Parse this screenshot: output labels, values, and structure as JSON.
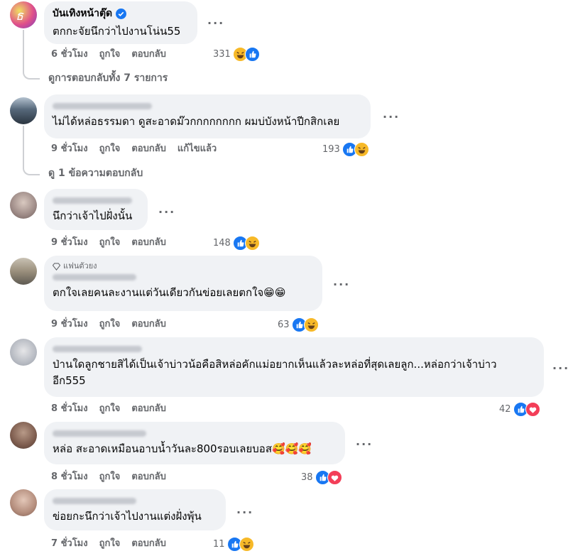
{
  "comments": [
    {
      "name": "บันเทิงหน้าตุ๊ด",
      "text": "ตกกะจัยนึกว่าไปงานโน่น55",
      "time": "6 ชั่วโมง",
      "like": "ถูกใจ",
      "reply": "ตอบกลับ",
      "count": "331",
      "view_replies": "ดูการตอบกลับทั้ง 7 รายการ"
    },
    {
      "text": "ไม่ได้หล่อธรรมดา ดูสะอาดม๊วกกกกกกกก ผมบ่บังหน้าปีกสิกเลย",
      "time": "9 ชั่วโมง",
      "like": "ถูกใจ",
      "reply": "ตอบกลับ",
      "edited": "แก้ไขแล้ว",
      "count": "193",
      "view_replies": "ดู 1 ข้อความตอบกลับ"
    },
    {
      "text": "นึกว่าเจ้าไปฝั่งนั้น",
      "time": "9 ชั่วโมง",
      "like": "ถูกใจ",
      "reply": "ตอบกลับ",
      "count": "148"
    },
    {
      "badge": "แฟนตัวยง",
      "text": "ตกใจเลยคนละงานแต่วันเดียวกันข่อยเลยตกใจ😁😁",
      "time": "9 ชั่วโมง",
      "like": "ถูกใจ",
      "reply": "ตอบกลับ",
      "count": "63"
    },
    {
      "text": "ป่านใดลูกชายสิได้เป็นเจ้าบ่าวน้อคือสิหล่อคักแม่อยากเห็นแล้วละหล่อที่สุดเลยลูก...หล่อกว่าเจ้าบ่าวอีก555",
      "time": "8 ชั่วโมง",
      "like": "ถูกใจ",
      "reply": "ตอบกลับ",
      "count": "42"
    },
    {
      "text": "หล่อ สะอาดเหมือนอาบน้ำวันละ800รอบเลยบอส🥰🥰🥰",
      "time": "8 ชั่วโมง",
      "like": "ถูกใจ",
      "reply": "ตอบกลับ",
      "count": "38"
    },
    {
      "text": "ข่อยกะนึกว่าเจ้าไปงานแต่งฝั่งพุ้น",
      "time": "7 ชั่วโมง",
      "like": "ถูกใจ",
      "reply": "ตอบกลับ",
      "count": "11"
    }
  ],
  "colors": {
    "bubble": "#f0f2f5",
    "like": "#1877f2",
    "haha": "#f7b928",
    "love": "#f33e58",
    "muted": "#65676b",
    "verified": "#1877f2"
  },
  "icons": {
    "like": "thumbs-up-icon",
    "haha": "laughing-face-icon",
    "love": "heart-icon",
    "verified": "verified-badge-icon",
    "fan": "diamond-icon",
    "more": "more-options-icon"
  }
}
